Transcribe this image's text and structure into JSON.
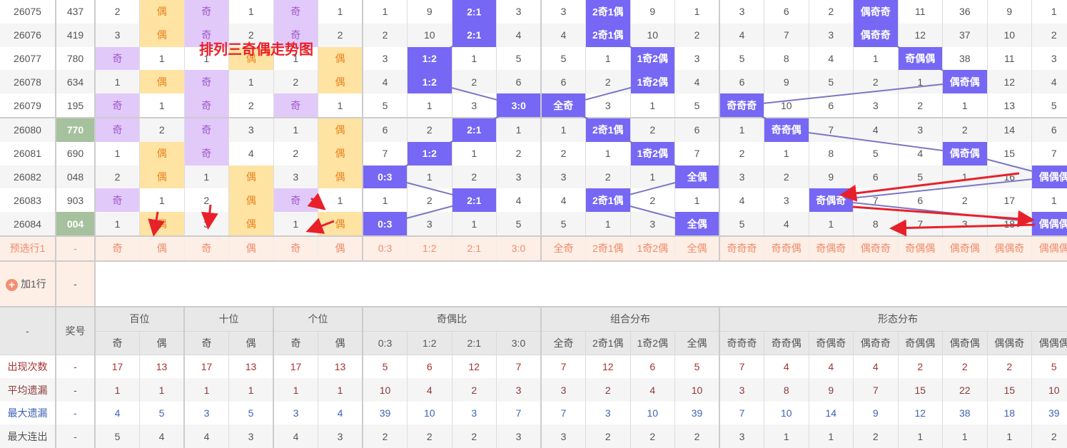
{
  "title_annotation": "排列三奇偶走势图",
  "colors": {
    "odd_bg": "#e1c9fa",
    "even_bg": "#ffe3a3",
    "hit_bg": "#7667f4",
    "number_hl": "#a6c19d",
    "annotation": "#e8202a",
    "trend_line": "#7b76c4"
  },
  "rows": [
    {
      "period": "26075",
      "number": "437",
      "hl": false,
      "cells": [
        "2",
        "偶",
        "奇",
        "1",
        "奇",
        "1",
        "1",
        "9",
        "2:1",
        "3",
        "3",
        "2奇1偶",
        "9",
        "1",
        "3",
        "6",
        "2",
        "偶奇奇",
        "11",
        "36",
        "9",
        "1"
      ]
    },
    {
      "period": "26076",
      "number": "419",
      "hl": false,
      "cells": [
        "3",
        "偶",
        "奇",
        "2",
        "奇",
        "2",
        "2",
        "10",
        "2:1",
        "4",
        "4",
        "2奇1偶",
        "10",
        "2",
        "4",
        "7",
        "3",
        "偶奇奇",
        "12",
        "37",
        "10",
        "2"
      ]
    },
    {
      "period": "26077",
      "number": "780",
      "hl": false,
      "cells": [
        "奇",
        "1",
        "1",
        "偶",
        "1",
        "偶",
        "3",
        "1:2",
        "1",
        "5",
        "5",
        "1",
        "1奇2偶",
        "3",
        "5",
        "8",
        "4",
        "1",
        "奇偶偶",
        "38",
        "11",
        "3"
      ]
    },
    {
      "period": "26078",
      "number": "634",
      "hl": false,
      "cells": [
        "1",
        "偶",
        "奇",
        "1",
        "2",
        "偶",
        "4",
        "1:2",
        "2",
        "6",
        "6",
        "2",
        "1奇2偶",
        "4",
        "6",
        "9",
        "5",
        "2",
        "1",
        "偶奇偶",
        "12",
        "4"
      ]
    },
    {
      "period": "26079",
      "number": "195",
      "hl": false,
      "cells": [
        "奇",
        "1",
        "奇",
        "2",
        "奇",
        "1",
        "5",
        "1",
        "3",
        "3:0",
        "全奇",
        "3",
        "1",
        "5",
        "奇奇奇",
        "10",
        "6",
        "3",
        "2",
        "1",
        "13",
        "5"
      ]
    },
    {
      "period": "26080",
      "number": "770",
      "hl": true,
      "cells": [
        "奇",
        "2",
        "奇",
        "3",
        "1",
        "偶",
        "6",
        "2",
        "2:1",
        "1",
        "1",
        "2奇1偶",
        "2",
        "6",
        "1",
        "奇奇偶",
        "7",
        "4",
        "3",
        "2",
        "14",
        "6"
      ]
    },
    {
      "period": "26081",
      "number": "690",
      "hl": false,
      "cells": [
        "1",
        "偶",
        "奇",
        "4",
        "2",
        "偶",
        "7",
        "1:2",
        "1",
        "2",
        "2",
        "1",
        "1奇2偶",
        "7",
        "2",
        "1",
        "8",
        "5",
        "4",
        "偶奇偶",
        "15",
        "7"
      ]
    },
    {
      "period": "26082",
      "number": "048",
      "hl": false,
      "cells": [
        "2",
        "偶",
        "1",
        "偶",
        "3",
        "偶",
        "0:3",
        "1",
        "2",
        "3",
        "3",
        "2",
        "1",
        "全偶",
        "3",
        "2",
        "9",
        "6",
        "5",
        "1",
        "16",
        "偶偶偶"
      ]
    },
    {
      "period": "26083",
      "number": "903",
      "hl": false,
      "cells": [
        "奇",
        "1",
        "2",
        "偶",
        "奇",
        "1",
        "1",
        "2",
        "2:1",
        "4",
        "4",
        "2奇1偶",
        "2",
        "1",
        "4",
        "3",
        "奇偶奇",
        "7",
        "6",
        "2",
        "17",
        "1"
      ]
    },
    {
      "period": "26084",
      "number": "004",
      "hl": true,
      "cells": [
        "1",
        "偶",
        "3",
        "偶",
        "1",
        "偶",
        "0:3",
        "3",
        "1",
        "5",
        "5",
        "1",
        "3",
        "全偶",
        "5",
        "4",
        "1",
        "8",
        "7",
        "3",
        "18",
        "偶偶偶"
      ]
    }
  ],
  "preselect": {
    "label": "预选行1",
    "number": "-",
    "cells": [
      "奇",
      "偶",
      "奇",
      "偶",
      "奇",
      "偶",
      "0:3",
      "1:2",
      "2:1",
      "3:0",
      "全奇",
      "2奇1偶",
      "1奇2偶",
      "全偶",
      "奇奇奇",
      "奇奇偶",
      "奇偶奇",
      "偶奇奇",
      "奇偶偶",
      "偶奇偶",
      "偶偶奇",
      "偶偶偶"
    ]
  },
  "add_row": {
    "label": "加1行",
    "number": "-"
  },
  "header": {
    "corner": "-",
    "number": "奖号",
    "groups": [
      "百位",
      "十位",
      "个位",
      "奇偶比",
      "组合分布",
      "形态分布"
    ],
    "sub": [
      "奇",
      "偶",
      "奇",
      "偶",
      "奇",
      "偶",
      "0:3",
      "1:2",
      "2:1",
      "3:0",
      "全奇",
      "2奇1偶",
      "1奇2偶",
      "全偶",
      "奇奇奇",
      "奇奇偶",
      "奇偶奇",
      "偶奇奇",
      "奇偶偶",
      "偶奇偶",
      "偶偶奇",
      "偶偶偶"
    ]
  },
  "stats": [
    {
      "label": "出现次数",
      "number": "-",
      "values": [
        "17",
        "13",
        "17",
        "13",
        "17",
        "13",
        "5",
        "6",
        "12",
        "7",
        "7",
        "12",
        "6",
        "5",
        "7",
        "4",
        "4",
        "4",
        "2",
        "2",
        "2",
        "5"
      ]
    },
    {
      "label": "平均遗漏",
      "number": "-",
      "values": [
        "1",
        "1",
        "1",
        "1",
        "1",
        "1",
        "10",
        "4",
        "2",
        "3",
        "3",
        "2",
        "4",
        "10",
        "3",
        "8",
        "9",
        "7",
        "15",
        "22",
        "15",
        "10"
      ]
    },
    {
      "label": "最大遗漏",
      "number": "-",
      "values": [
        "4",
        "5",
        "3",
        "5",
        "3",
        "4",
        "39",
        "10",
        "3",
        "7",
        "7",
        "3",
        "10",
        "39",
        "7",
        "10",
        "14",
        "9",
        "12",
        "38",
        "18",
        "39"
      ]
    },
    {
      "label": "最大连出",
      "number": "-",
      "values": [
        "5",
        "4",
        "4",
        "3",
        "4",
        "3",
        "2",
        "2",
        "2",
        "3",
        "3",
        "2",
        "2",
        "2",
        "3",
        "1",
        "1",
        "2",
        "1",
        "1",
        "1",
        "2"
      ]
    }
  ]
}
